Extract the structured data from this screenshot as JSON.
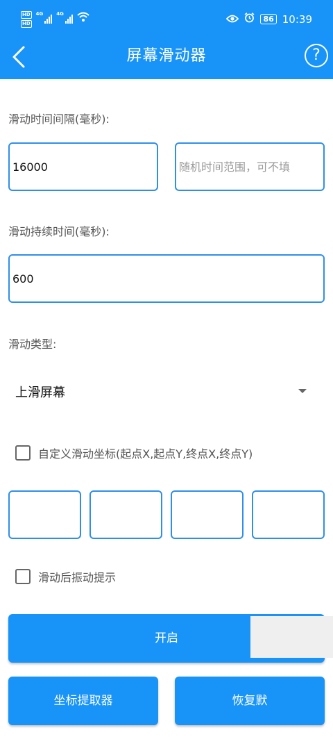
{
  "status_bar": {
    "hd_1": "HD",
    "hd_2": "HD",
    "net_1": "4G",
    "net_2": "4G",
    "battery": "86",
    "time": "10:39"
  },
  "app_bar": {
    "title": "屏幕滑动器",
    "help": "?"
  },
  "form": {
    "interval_label": "滑动时间间隔(毫秒):",
    "interval_value": "16000",
    "random_placeholder": "随机时间范围，可不填",
    "duration_label": "滑动持续时间(毫秒):",
    "duration_value": "600",
    "type_label": "滑动类型:",
    "type_selected": "上滑屏幕",
    "custom_coord_label": "自定义滑动坐标(起点X,起点Y,终点X,终点Y)",
    "coords": [
      "",
      "",
      "",
      ""
    ],
    "vibrate_label": "滑动后振动提示"
  },
  "buttons": {
    "start": "开启",
    "coord_picker": "坐标提取器",
    "restore": "恢复默"
  },
  "colors": {
    "primary": "#1893F8",
    "border": "#2E8FE8"
  }
}
